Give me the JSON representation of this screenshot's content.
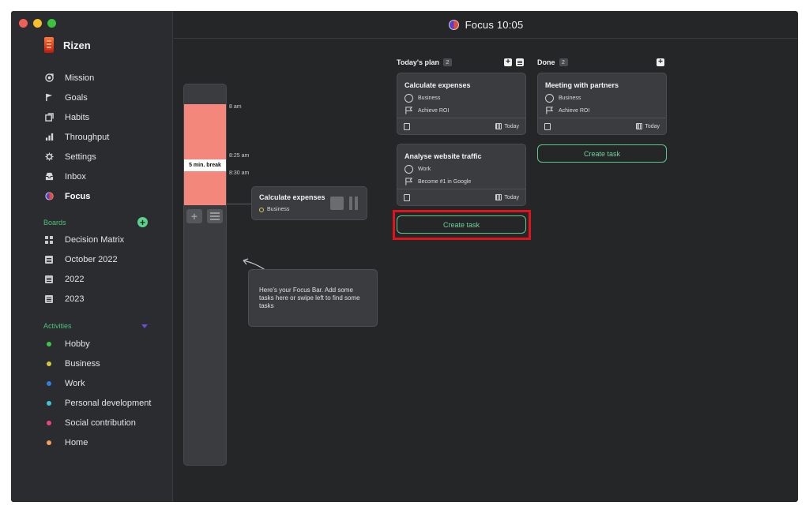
{
  "app": {
    "brand": "Rizen",
    "header_title": "Focus 10:05"
  },
  "sidebar": {
    "nav": [
      {
        "label": "Mission",
        "icon": "target-icon"
      },
      {
        "label": "Goals",
        "icon": "flag-icon"
      },
      {
        "label": "Habits",
        "icon": "habits-icon"
      },
      {
        "label": "Throughput",
        "icon": "bar-chart-icon"
      },
      {
        "label": "Settings",
        "icon": "gear-icon"
      },
      {
        "label": "Inbox",
        "icon": "inbox-icon"
      },
      {
        "label": "Focus",
        "icon": "focus-icon",
        "active": true
      }
    ],
    "boards_title": "Boards",
    "boards": [
      {
        "label": "Decision Matrix",
        "icon": "grid-icon"
      },
      {
        "label": "October 2022",
        "icon": "document-icon"
      },
      {
        "label": "2022",
        "icon": "document-icon"
      },
      {
        "label": "2023",
        "icon": "document-icon"
      }
    ],
    "activities_title": "Activities",
    "activities": [
      {
        "label": "Hobby",
        "color": "#3cc84a"
      },
      {
        "label": "Business",
        "color": "#d6c83a"
      },
      {
        "label": "Work",
        "color": "#2f7fe0"
      },
      {
        "label": "Personal development",
        "color": "#3fc4d8"
      },
      {
        "label": "Social contribution",
        "color": "#e8467a"
      },
      {
        "label": "Home",
        "color": "#f2a25a"
      }
    ]
  },
  "focusbar": {
    "break_label": "5 min. break",
    "times": [
      "8 am",
      "8:25 am",
      "8:30 am"
    ]
  },
  "focus_card": {
    "title": "Calculate expenses",
    "tag": "Business"
  },
  "tooltip": {
    "text": "Here's your Focus Bar. Add some tasks here or swipe left to find some tasks"
  },
  "columns": {
    "plan": {
      "title": "Today's plan",
      "count": "2",
      "cards": [
        {
          "title": "Calculate expenses",
          "activity": "Business",
          "goal": "Achieve ROI",
          "date": "Today"
        },
        {
          "title": "Analyse website traffic",
          "activity": "Work",
          "goal": "Become #1 in Google",
          "date": "Today"
        }
      ],
      "create_label": "Create task"
    },
    "done": {
      "title": "Done",
      "count": "2",
      "cards": [
        {
          "title": "Meeting with partners",
          "activity": "Business",
          "goal": "Achieve ROI",
          "date": "Today"
        }
      ],
      "create_label": "Create task"
    }
  }
}
